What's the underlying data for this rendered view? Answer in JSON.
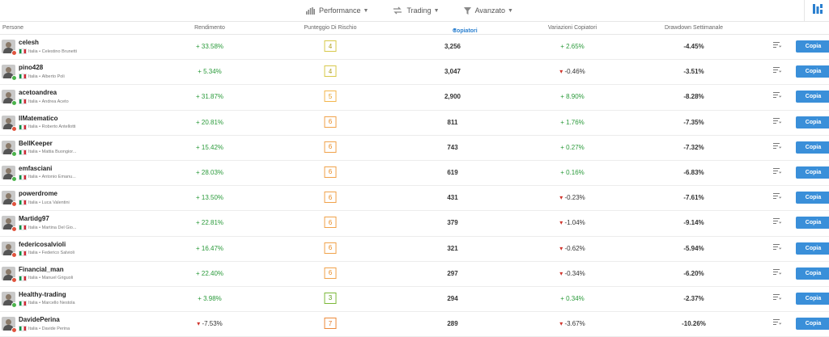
{
  "filters": [
    {
      "label": "Performance",
      "icon": "bar-chart-icon"
    },
    {
      "label": "Trading",
      "icon": "trading-icon"
    },
    {
      "label": "Avanzato",
      "icon": "funnel-icon"
    }
  ],
  "columns": {
    "persone": "Persone",
    "rendimento": "Rendimento",
    "rischio": "Punteggio Di Rischio",
    "copiatori": "Copiatori",
    "variazioni": "Variazioni Copiatori",
    "drawdown": "Drawdown Settimanale"
  },
  "copy_label": "Copia",
  "colors": {
    "accent": "#3a8fd9",
    "positive": "#2a9a3a",
    "negative": "#d0342c"
  },
  "rows": [
    {
      "username": "celesh",
      "country": "Italia",
      "fullname": "Celestino Brunetti",
      "online": false,
      "rendimento": "33.58%",
      "rend_pos": true,
      "risk": "4",
      "copiatori": "3,256",
      "variazione": "2.65%",
      "var_pos": true,
      "drawdown": "-4.45%"
    },
    {
      "username": "pino428",
      "country": "Italia",
      "fullname": "Alberto Poli",
      "online": true,
      "rendimento": "5.34%",
      "rend_pos": true,
      "risk": "4",
      "copiatori": "3,047",
      "variazione": "-0.46%",
      "var_pos": false,
      "drawdown": "-3.51%"
    },
    {
      "username": "acetoandrea",
      "country": "Italia",
      "fullname": "Andrea Aceto",
      "online": true,
      "rendimento": "31.87%",
      "rend_pos": true,
      "risk": "5",
      "copiatori": "2,900",
      "variazione": "8.90%",
      "var_pos": true,
      "drawdown": "-8.28%"
    },
    {
      "username": "IlMatematico",
      "country": "Italia",
      "fullname": "Roberto Antellotti",
      "online": false,
      "rendimento": "20.81%",
      "rend_pos": true,
      "risk": "6",
      "copiatori": "811",
      "variazione": "1.76%",
      "var_pos": true,
      "drawdown": "-7.35%"
    },
    {
      "username": "BellKeeper",
      "country": "Italia",
      "fullname": "Mattia Buongior...",
      "online": true,
      "rendimento": "15.42%",
      "rend_pos": true,
      "risk": "6",
      "copiatori": "743",
      "variazione": "0.27%",
      "var_pos": true,
      "drawdown": "-7.32%"
    },
    {
      "username": "emfasciani",
      "country": "Italia",
      "fullname": "Antonio Emanu...",
      "online": true,
      "rendimento": "28.03%",
      "rend_pos": true,
      "risk": "6",
      "copiatori": "619",
      "variazione": "0.16%",
      "var_pos": true,
      "drawdown": "-6.83%"
    },
    {
      "username": "powerdrome",
      "country": "Italia",
      "fullname": "Luca Valentini",
      "online": false,
      "rendimento": "13.50%",
      "rend_pos": true,
      "risk": "6",
      "copiatori": "431",
      "variazione": "-0.23%",
      "var_pos": false,
      "drawdown": "-7.61%"
    },
    {
      "username": "Martidg97",
      "country": "Italia",
      "fullname": "Martina Del Gio...",
      "online": false,
      "rendimento": "22.81%",
      "rend_pos": true,
      "risk": "6",
      "copiatori": "379",
      "variazione": "-1.04%",
      "var_pos": false,
      "drawdown": "-9.14%"
    },
    {
      "username": "federicosalvioli",
      "country": "Italia",
      "fullname": "Federico Salvioli",
      "online": false,
      "rendimento": "16.47%",
      "rend_pos": true,
      "risk": "6",
      "copiatori": "321",
      "variazione": "-0.62%",
      "var_pos": false,
      "drawdown": "-5.94%"
    },
    {
      "username": "Financial_man",
      "country": "Italia",
      "fullname": "Manuel Griguoli",
      "online": false,
      "rendimento": "22.40%",
      "rend_pos": true,
      "risk": "6",
      "copiatori": "297",
      "variazione": "-0.34%",
      "var_pos": false,
      "drawdown": "-6.20%"
    },
    {
      "username": "Healthy-trading",
      "country": "Italia",
      "fullname": "Marcello Nestola",
      "online": true,
      "rendimento": "3.98%",
      "rend_pos": true,
      "risk": "3",
      "copiatori": "294",
      "variazione": "0.34%",
      "var_pos": true,
      "drawdown": "-2.37%"
    },
    {
      "username": "DavidePerina",
      "country": "Italia",
      "fullname": "Davide Perina",
      "online": false,
      "rendimento": "-7.53%",
      "rend_pos": false,
      "risk": "7",
      "copiatori": "289",
      "variazione": "-3.67%",
      "var_pos": false,
      "drawdown": "-10.26%"
    }
  ]
}
